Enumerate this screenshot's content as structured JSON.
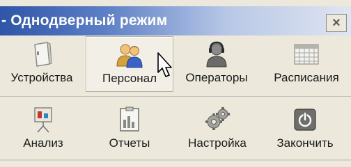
{
  "window": {
    "title": "- Однодверный режим",
    "close_glyph": "×"
  },
  "toolbar_top": [
    {
      "label": "Устройства",
      "icon": "door-panel-icon"
    },
    {
      "label": "Персонал",
      "icon": "people-icon"
    },
    {
      "label": "Операторы",
      "icon": "operator-headset-icon"
    },
    {
      "label": "Расписания",
      "icon": "calendar-grid-icon"
    }
  ],
  "toolbar_bottom": [
    {
      "label": "Анализ",
      "icon": "presentation-board-icon"
    },
    {
      "label": "Отчеты",
      "icon": "report-chart-icon"
    },
    {
      "label": "Настройка",
      "icon": "gears-icon"
    },
    {
      "label": "Закончить",
      "icon": "power-icon"
    }
  ],
  "colors": {
    "titlebar_start": "#2f55a8",
    "titlebar_end": "#dfe5f1",
    "toolbar_bg": "#ece9dc"
  }
}
